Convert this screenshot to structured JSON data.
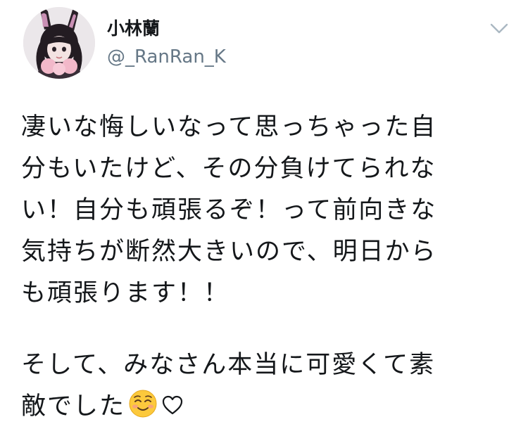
{
  "tweet": {
    "author": {
      "display_name": "小林蘭",
      "handle": "@_RanRan_K",
      "avatar_icon": "profile-photo"
    },
    "menu_icon": "chevron-down-icon",
    "paragraphs": [
      {
        "lines": [
          "凄いな悔しいなって思っちゃった自",
          "分もいたけど、その分負けてられな",
          "い！自分も頑張るぞ！って前向きな",
          "気持ちが断然大きいので、明日から",
          "も頑張ります！！"
        ]
      },
      {
        "lines": [
          "そして、みなさん本当に可愛くて素",
          "敵でした"
        ],
        "trailing_icons": [
          "smiling-face-emoji-icon",
          "heart-outline-icon"
        ]
      }
    ]
  },
  "colors": {
    "text": "#14171a",
    "secondary": "#657786",
    "chevron": "#aab8c2"
  }
}
